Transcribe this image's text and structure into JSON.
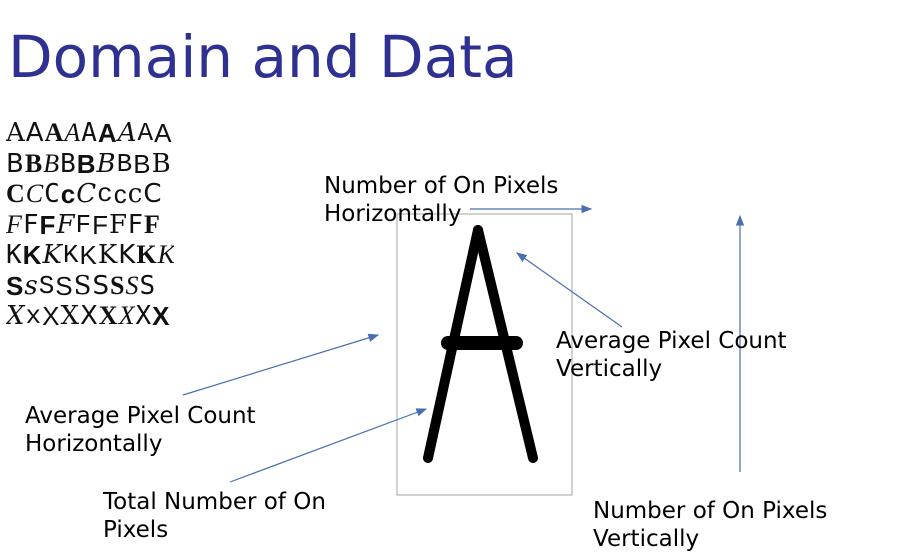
{
  "title": "Domain and Data",
  "font_samples": [
    {
      "glyphs": [
        "A",
        "A",
        "A",
        "A",
        "A",
        "A",
        "A",
        "A",
        "A"
      ]
    },
    {
      "glyphs": [
        "B",
        "B",
        "B",
        "B",
        "B",
        "B",
        "B",
        "B",
        "B"
      ]
    },
    {
      "glyphs": [
        "C",
        "C",
        "C",
        "c",
        "C",
        "c",
        "c",
        "c",
        "C"
      ]
    },
    {
      "glyphs": [
        "F",
        "F",
        "F",
        "F",
        "F",
        "F",
        "F",
        "F",
        "F"
      ]
    },
    {
      "glyphs": [
        "K",
        "K",
        "K",
        "K",
        "K",
        "K",
        "K",
        "K",
        "K"
      ]
    },
    {
      "glyphs": [
        "S",
        "s",
        "S",
        "S",
        "S",
        "S",
        "S",
        "S",
        "S"
      ]
    },
    {
      "glyphs": [
        "X",
        "x",
        "X",
        "X",
        "X",
        "X",
        "X",
        "X",
        "X"
      ]
    }
  ],
  "sample_letter": "A",
  "labels": {
    "on_pixels_horizontal": [
      "Number of On Pixels",
      "Horizontally"
    ],
    "avg_pixel_horizontal": [
      "Average Pixel Count",
      "Horizontally"
    ],
    "total_on_pixels": [
      "Total Number of On",
      "Pixels"
    ],
    "avg_pixel_vertical": [
      "Average Pixel Count",
      "Vertically"
    ],
    "on_pixels_vertical": [
      "Number of On Pixels",
      "Vertically"
    ]
  },
  "colors": {
    "title": "#2e3192",
    "arrow": "#4a6fb0",
    "frame": "#a6a6a6"
  }
}
